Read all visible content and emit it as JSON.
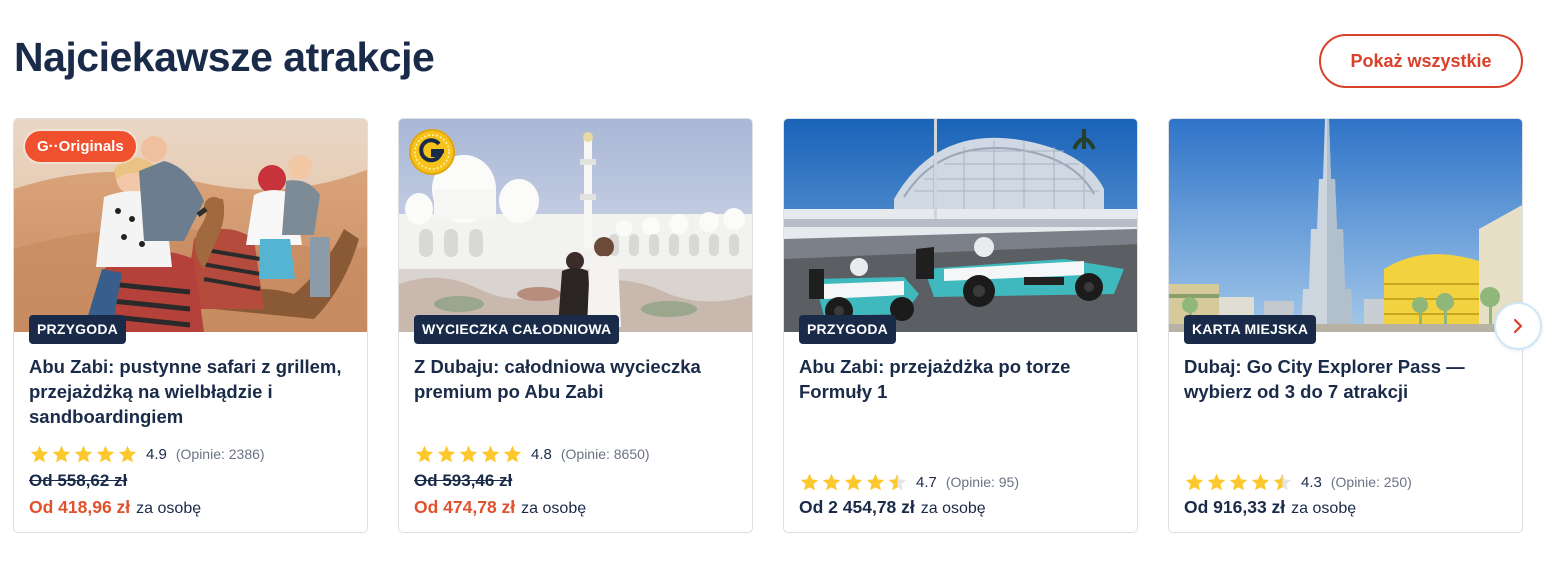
{
  "section": {
    "title": "Najciekawsze atrakcje",
    "show_all_label": "Pokaż wszystkie"
  },
  "colors": {
    "brand_navy": "#1a2b49",
    "sale_red": "#e0522d",
    "outline_red": "#d9412b",
    "star_yellow": "#fdc82e"
  },
  "cards": [
    {
      "badge": "G··Originals",
      "category": "PRZYGODA",
      "title": "Abu Zabi: pustynne safari z grillem, przejażdżką na wielbłądzie i sandboardingiem",
      "rating": "4.9",
      "reviews": "(Opinie: 2386)",
      "old_price": "Od 558,62 zł",
      "price": "Od 418,96 zł",
      "per": "za osobę"
    },
    {
      "badge_icon": "g-coin-icon",
      "category": "WYCIECZKA CAŁODNIOWA",
      "title": "Z Dubaju: całodniowa wycieczka premium po Abu Zabi",
      "rating": "4.8",
      "reviews": "(Opinie: 8650)",
      "old_price": "Od 593,46 zł",
      "price": "Od 474,78 zł",
      "per": "za osobę"
    },
    {
      "category": "PRZYGODA",
      "title": "Abu Zabi: przejażdżka po torze Formuły 1",
      "rating": "4.7",
      "reviews": "(Opinie: 95)",
      "price": "Od 2 454,78 zł",
      "per": "za osobę"
    },
    {
      "category": "KARTA MIEJSKA",
      "title": "Dubaj: Go City Explorer Pass — wybierz od 3 do 7 atrakcji",
      "rating": "4.3",
      "reviews": "(Opinie: 250)",
      "price": "Od 916,33 zł",
      "per": "za osobę"
    }
  ],
  "carousel": {
    "next_icon": "chevron-right-icon"
  }
}
